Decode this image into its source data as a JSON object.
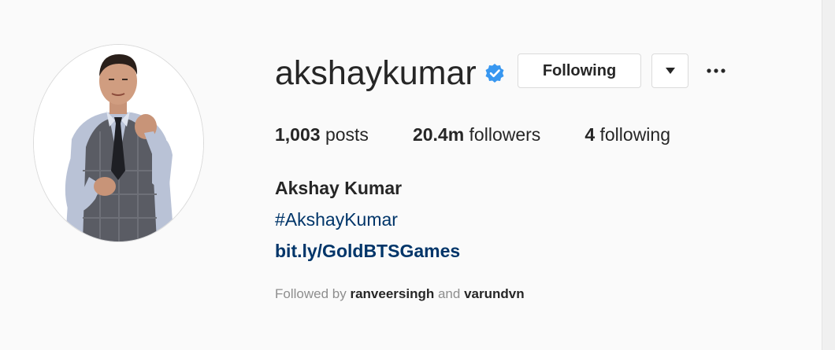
{
  "profile": {
    "username": "akshaykumar",
    "verified": true,
    "full_name": "Akshay Kumar",
    "bio_hashtag": "#AkshayKumar",
    "bio_link": "bit.ly/GoldBTSGames"
  },
  "actions": {
    "follow_label": "Following",
    "dropdown_icon": "caret-down-icon",
    "more_icon": "ellipsis-icon"
  },
  "stats": {
    "posts_count": "1,003",
    "posts_label": "posts",
    "followers_count": "20.4m",
    "followers_label": "followers",
    "following_count": "4",
    "following_label": "following"
  },
  "followed_by": {
    "prefix": "Followed by",
    "account_1": "ranveersingh",
    "conjunction": "and",
    "account_2": "varundvn"
  },
  "colors": {
    "background": "#fafafa",
    "verified_badge": "#3897f0",
    "link_text": "#003569",
    "muted_text": "#8e8e8e"
  }
}
